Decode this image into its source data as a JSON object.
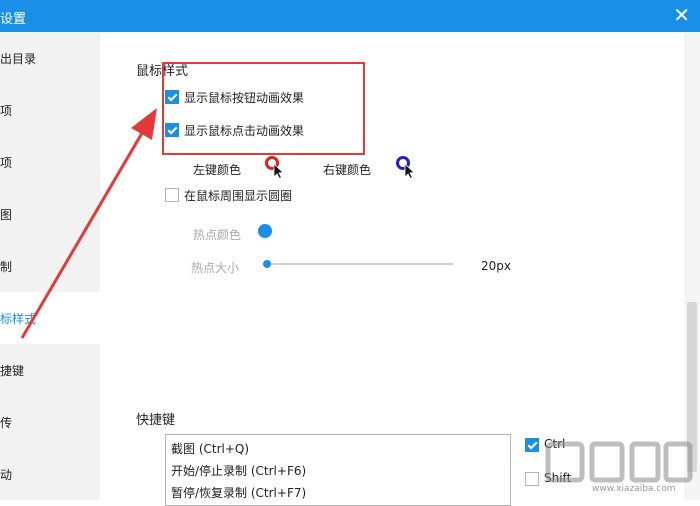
{
  "window": {
    "title": "设置",
    "close_glyph": "✕"
  },
  "sidebar": {
    "items": [
      {
        "label": "出目录"
      },
      {
        "label": "项"
      },
      {
        "label": "项"
      },
      {
        "label": "图"
      },
      {
        "label": "制"
      },
      {
        "label": "标样式",
        "active": true
      },
      {
        "label": "捷键"
      },
      {
        "label": "传"
      },
      {
        "label": "动"
      }
    ]
  },
  "mouse_style": {
    "title": "鼠标样式",
    "show_button_anim": {
      "label": "显示鼠标按钮动画效果",
      "checked": true
    },
    "show_click_anim": {
      "label": "显示鼠标点击动画效果",
      "checked": true
    },
    "left_key_color_label": "左键颜色",
    "left_key_color": "#e01f1f",
    "right_key_color_label": "右键颜色",
    "right_key_color": "#1c20c8",
    "show_circle": {
      "label": "在鼠标周围显示圆圈",
      "checked": false
    },
    "hotspot_color_label": "热点颜色",
    "hotspot_color": "#1a8fe8",
    "hotspot_size_label": "热点大小",
    "hotspot_size_value": "20px",
    "hotspot_size_fraction": 0.0
  },
  "shortcuts": {
    "title": "快捷键",
    "items": [
      "截图 (Ctrl+Q)",
      "开始/停止录制  (Ctrl+F6)",
      "暂停/恢复录制  (Ctrl+F7)"
    ],
    "ctrl": {
      "label": "Ctrl",
      "checked": true
    },
    "shift": {
      "label": "Shift",
      "checked": false
    }
  },
  "watermark": {
    "url": "www.xiazaiba.com"
  },
  "colors": {
    "accent": "#1a8fe8",
    "highlight_box": "#e53838",
    "arrow": "#e53838"
  }
}
